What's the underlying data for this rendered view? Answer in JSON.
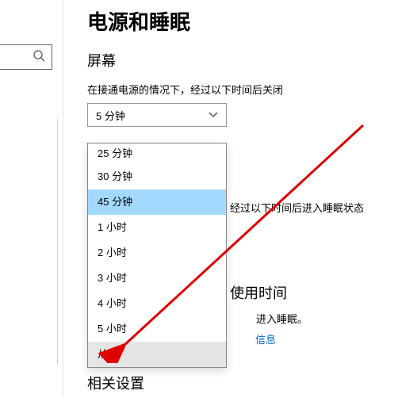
{
  "page_title": "电源和睡眠",
  "section_screen": "屏幕",
  "screen_label": "在接通电源的情况下，经过以下时间后关闭",
  "dropdown_selected": "5 分钟",
  "dropdown_options": {
    "opt25": "25 分钟",
    "opt30": "30 分钟",
    "opt45": "45 分钟",
    "opt1h": "1 小时",
    "opt2h": "2 小时",
    "opt3h": "3 小时",
    "opt4h": "4 小时",
    "opt5h": "5 小时",
    "optnever": "从不"
  },
  "sleep_fragment": "经过以下时间后进入睡眠状态",
  "usage_title": "使用时间",
  "sleep_fragment2": "进入睡眠。",
  "info_link": "信息",
  "related_settings": "相关设置"
}
